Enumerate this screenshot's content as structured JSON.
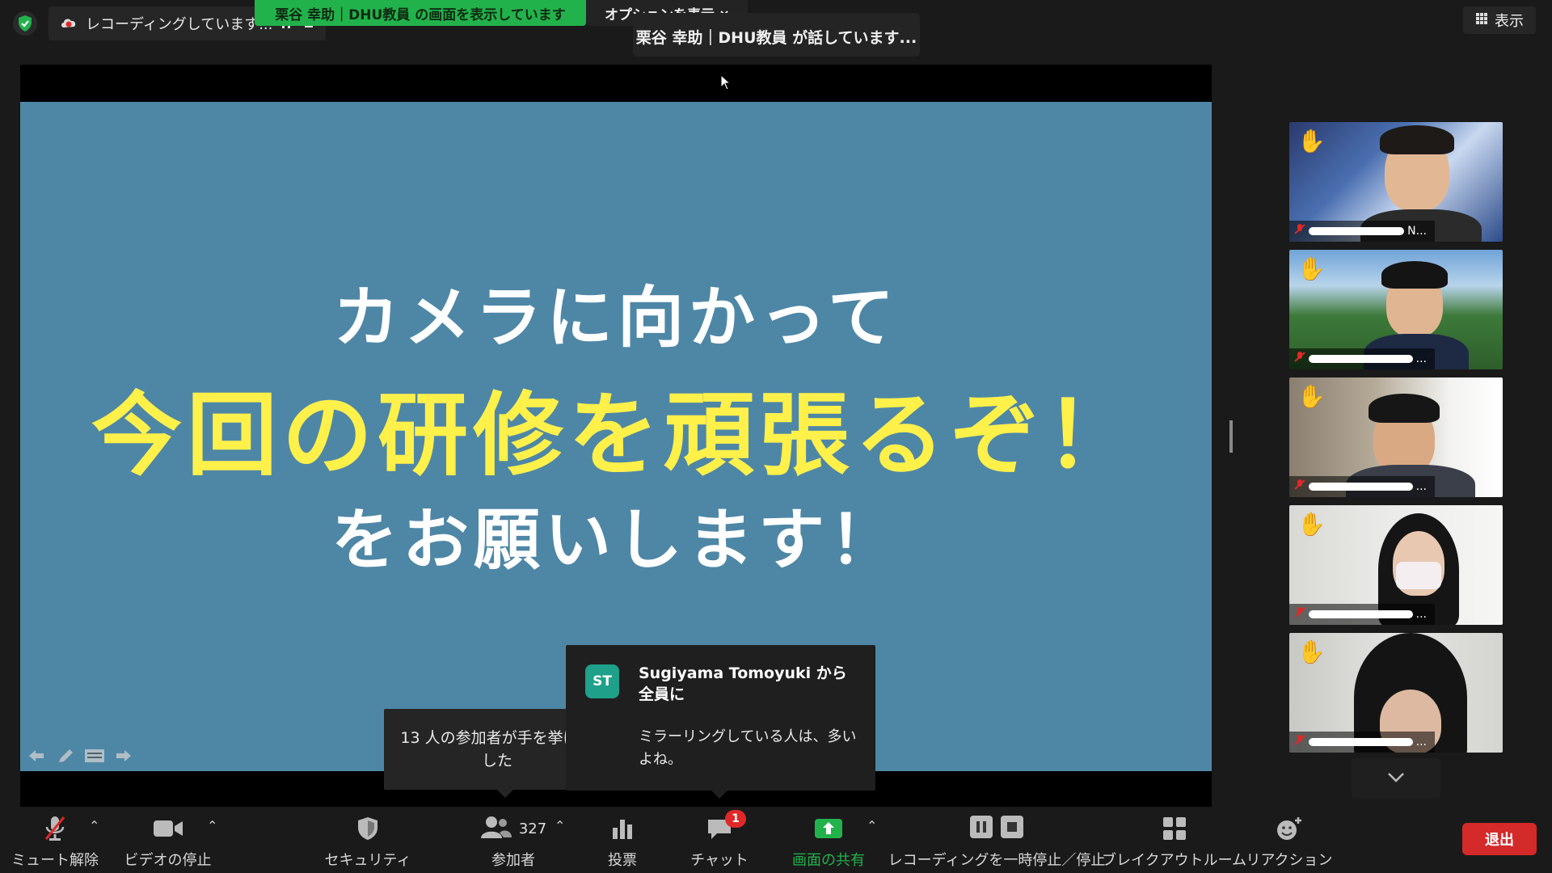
{
  "topbar": {
    "recording_status": "レコーディングしています...",
    "share_banner": "栗谷 幸助｜DHU教員 の画面を表示しています",
    "options_label": "オプションを表示",
    "speaker_status": "栗谷 幸助｜DHU教員 が話しています...",
    "view_label": "表示"
  },
  "slide": {
    "line1": "カメラに向かって",
    "line2": "今回の研修を頑張るぞ！",
    "line3": "をお願いします！"
  },
  "hands_popup": {
    "text": "13 人の参加者が手を挙げました"
  },
  "chat_popup": {
    "avatar": "ST",
    "sender": "Sugiyama Tomoyuki から全員に",
    "message": "ミラーリングしている人は、多いよね。"
  },
  "gallery": {
    "tiles": [
      {
        "hand": "✋",
        "name_suffix": "N..."
      },
      {
        "hand": "✋",
        "name_suffix": "..."
      },
      {
        "hand": "✋",
        "name_suffix": "..."
      },
      {
        "hand": "✋",
        "name_suffix": "..."
      },
      {
        "hand": "✋",
        "name_suffix": "..."
      }
    ]
  },
  "toolbar": {
    "mute_label": "ミュート解除",
    "video_label": "ビデオの停止",
    "security_label": "セキュリティ",
    "participants_label": "参加者",
    "participants_count": "327",
    "polls_label": "投票",
    "chat_label": "チャット",
    "chat_badge": "1",
    "share_label": "画面の共有",
    "recording_label": "レコーディングを一時停止／停止",
    "breakout_label": "ブレイクアウトルーム",
    "reactions_label": "リアクション",
    "leave_label": "退出"
  },
  "colors": {
    "share_green": "#22b24c",
    "slide_blue": "#4e87a6",
    "slide_yellow": "#fff04a",
    "leave_red": "#d42a2a",
    "chat_avatar": "#1ea08a"
  },
  "icons": [
    "shield-check-icon",
    "cloud-record-icon",
    "pause-icon",
    "stop-icon",
    "chevron-down-icon",
    "grid-icon",
    "microphone-muted-icon",
    "video-camera-icon",
    "security-shield-icon",
    "participants-icon",
    "poll-icon",
    "chat-bubble-icon",
    "share-screen-icon",
    "breakout-icon",
    "reaction-icon",
    "hand-raise-icon"
  ]
}
